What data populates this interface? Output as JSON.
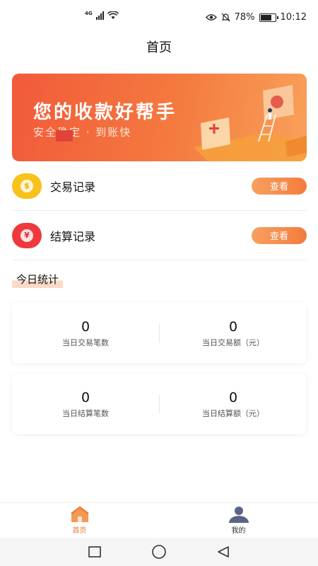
{
  "status_bar": {
    "network_type": "4G",
    "battery_percent": "78%",
    "battery_level": 0.78,
    "time": "10:12"
  },
  "header": {
    "title": "首页"
  },
  "banner": {
    "title": "您的收款好帮手",
    "subtitle": "安全稳定 · 到账快",
    "colors": {
      "start": "#f15a3a",
      "end": "#f8a15a"
    }
  },
  "menu": [
    {
      "label": "交易记录",
      "icon": "yuan-coin-yellow-icon",
      "button_label": "查看"
    },
    {
      "label": "结算记录",
      "icon": "yuan-coin-red-icon",
      "button_label": "查看"
    }
  ],
  "stats_section": {
    "heading": "今日统计"
  },
  "stat_cards": [
    {
      "left": {
        "value": "0",
        "label": "当日交易笔数"
      },
      "right": {
        "value": "0",
        "label": "当日交易额（元）"
      }
    },
    {
      "left": {
        "value": "0",
        "label": "当日结算笔数"
      },
      "right": {
        "value": "0",
        "label": "当日结算额（元）"
      }
    }
  ],
  "bottom_nav": [
    {
      "label": "首页",
      "icon": "home-icon",
      "active": true
    },
    {
      "label": "我的",
      "icon": "user-icon",
      "active": false
    }
  ],
  "accent_color": "#f0743c"
}
